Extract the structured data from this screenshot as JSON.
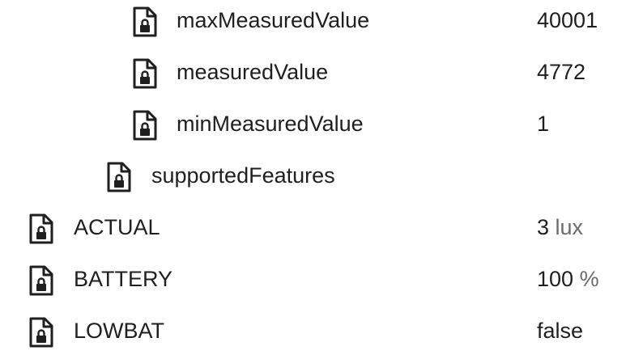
{
  "rows": [
    {
      "name": "maxMeasuredValue",
      "value": "40001",
      "unit": ""
    },
    {
      "name": "measuredValue",
      "value": "4772",
      "unit": ""
    },
    {
      "name": "minMeasuredValue",
      "value": "1",
      "unit": ""
    },
    {
      "name": "supportedFeatures",
      "value": "",
      "unit": ""
    },
    {
      "name": "ACTUAL",
      "value": "3",
      "unit": "lux"
    },
    {
      "name": "BATTERY",
      "value": "100",
      "unit": "%"
    },
    {
      "name": "LOWBAT",
      "value": "false",
      "unit": ""
    }
  ],
  "icon": "locked-file-icon",
  "colors": {
    "text": "#1f1f1f",
    "unit": "#6b6b6b",
    "icon": "#1f1f1f",
    "background": "#ffffff"
  }
}
